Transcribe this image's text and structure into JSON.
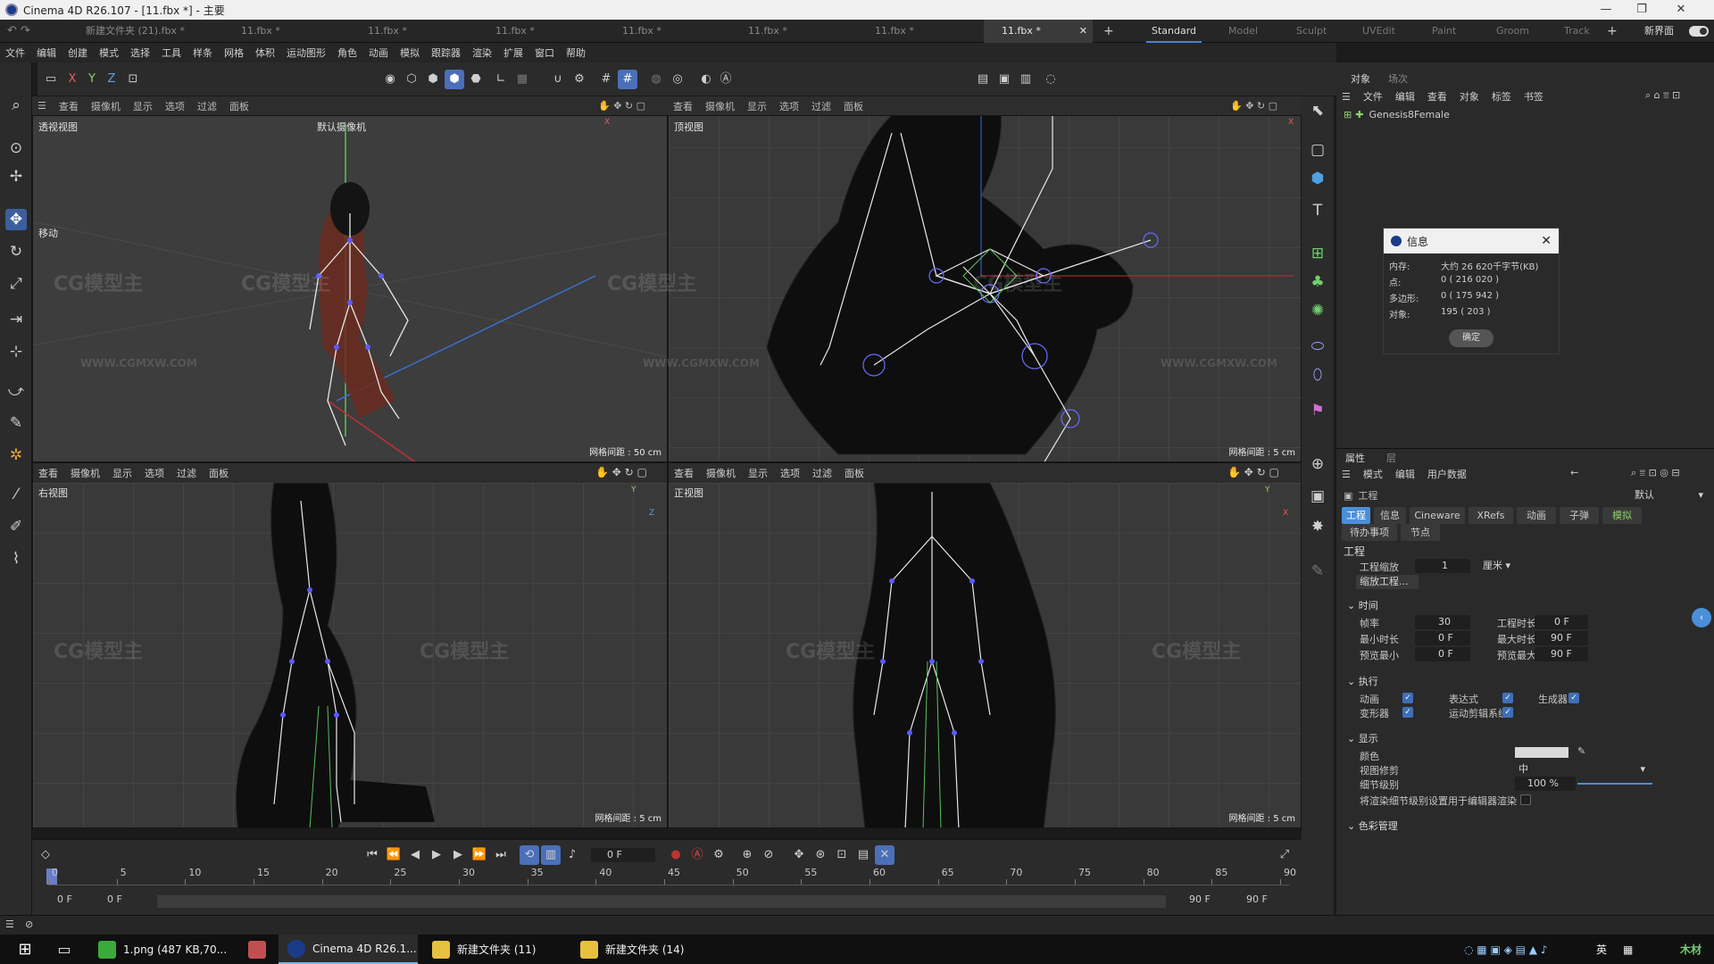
{
  "window": {
    "title": "Cinema 4D R26.107 - [11.fbx *] - 主要",
    "controls": [
      "—",
      "❐",
      "✕"
    ]
  },
  "tabs": {
    "files": [
      "新建文件夹 (21).fbx *",
      "11.fbx *",
      "11.fbx *",
      "11.fbx *",
      "11.fbx *",
      "11.fbx *",
      "11.fbx *",
      "11.fbx *"
    ],
    "active_file": "11.fbx *",
    "close": "✕",
    "add": "+",
    "layouts": [
      "Standard",
      "Model",
      "Sculpt",
      "UVEdit",
      "Paint",
      "Groom",
      "Track"
    ],
    "new_layout": "新界面"
  },
  "menu": [
    "文件",
    "编辑",
    "创建",
    "模式",
    "选择",
    "工具",
    "样条",
    "网格",
    "体积",
    "运动图形",
    "角色",
    "动画",
    "模拟",
    "跟踪器",
    "渲染",
    "扩展",
    "窗口",
    "帮助"
  ],
  "toolbar": {
    "axes": [
      "X",
      "Y",
      "Z"
    ]
  },
  "viewports": [
    {
      "name": "透视视图",
      "camera": "默认摄像机",
      "grid": "网格间距 : 50 cm",
      "menu": [
        "查看",
        "摄像机",
        "显示",
        "选项",
        "过滤",
        "面板"
      ],
      "tool": "移动"
    },
    {
      "name": "顶视图",
      "grid": "网格间距 : 5 cm",
      "menu": [
        "查看",
        "摄像机",
        "显示",
        "选项",
        "过滤",
        "面板"
      ]
    },
    {
      "name": "右视图",
      "grid": "网格间距 : 5 cm",
      "menu": [
        "查看",
        "摄像机",
        "显示",
        "选项",
        "过滤",
        "面板"
      ]
    },
    {
      "name": "正视图",
      "grid": "网格间距 : 5 cm",
      "menu": [
        "查看",
        "摄像机",
        "显示",
        "选项",
        "过滤",
        "面板"
      ]
    }
  ],
  "watermark": {
    "logo": "CG模型主",
    "url": "WWW.CGMXW.COM"
  },
  "objects": {
    "tabs": [
      "对象",
      "场次"
    ],
    "menu": [
      "文件",
      "编辑",
      "查看",
      "对象",
      "标签",
      "书签"
    ],
    "item": "Genesis8Female"
  },
  "dialog": {
    "title": "信息",
    "rows": [
      {
        "k": "内存:",
        "v": "大约 26 620千字节(KB)"
      },
      {
        "k": "点:",
        "v": "0 ( 216 020 )"
      },
      {
        "k": "多边形:",
        "v": "0 ( 175 942 )"
      },
      {
        "k": "对象:",
        "v": "195 ( 203 )"
      }
    ],
    "ok": "确定",
    "close": "✕"
  },
  "attributes": {
    "tabs": [
      "属性",
      "层"
    ],
    "menu": [
      "模式",
      "编辑",
      "用户数据"
    ],
    "mode": "默认",
    "head": "工程",
    "tabs_row1": [
      "工程",
      "信息",
      "Cineware",
      "XRefs",
      "动画",
      "子弹",
      "模拟"
    ],
    "tabs_row2": [
      "待办事项",
      "节点"
    ],
    "section_title": "工程",
    "scale_label": "工程缩放",
    "scale_value": "1",
    "scale_unit": "厘米",
    "scale_btn": "缩放工程...",
    "time_section": "时间",
    "fps_label": "帧率",
    "fps": "30",
    "duration_label": "工程时长",
    "duration": "0 F",
    "min_label": "最小时长",
    "min": "0 F",
    "max_label": "最大时长",
    "max": "90 F",
    "pmin_label": "预览最小",
    "pmin": "0 F",
    "pmax_label": "预览最大",
    "pmax": "90 F",
    "exec_section": "执行",
    "anim_label": "动画",
    "expr_label": "表达式",
    "gen_label": "生成器",
    "deform_label": "变形器",
    "mograph_label": "运动剪辑系统",
    "display_section": "显示",
    "color_label": "颜色",
    "clip_label": "视图修剪",
    "clip_value": "中",
    "lod_label": "细节级别",
    "lod_value": "100 %",
    "lod_level": 1.0,
    "render_lod_label": "将渲染细节级别设置用于编辑器渲染",
    "color_mgmt": "色彩管理"
  },
  "timeline": {
    "frame": "0 F",
    "ticks": [
      "0",
      "5",
      "10",
      "15",
      "20",
      "25",
      "30",
      "35",
      "40",
      "45",
      "50",
      "55",
      "60",
      "65",
      "70",
      "75",
      "80",
      "85",
      "90"
    ],
    "start": "0 F",
    "start2": "0 F",
    "end": "90 F",
    "end2": "90 F"
  },
  "taskbar": {
    "items": [
      "1.png (487 KB,70...",
      "Cinema 4D R26.1...",
      "新建文件夹 (11)",
      "新建文件夹 (14)"
    ],
    "ime": "英",
    "brand": "木材"
  },
  "colors": {
    "accent": "#4b8fd8",
    "skeleton": "#e8e8e8",
    "joint": "#5a5aff"
  }
}
